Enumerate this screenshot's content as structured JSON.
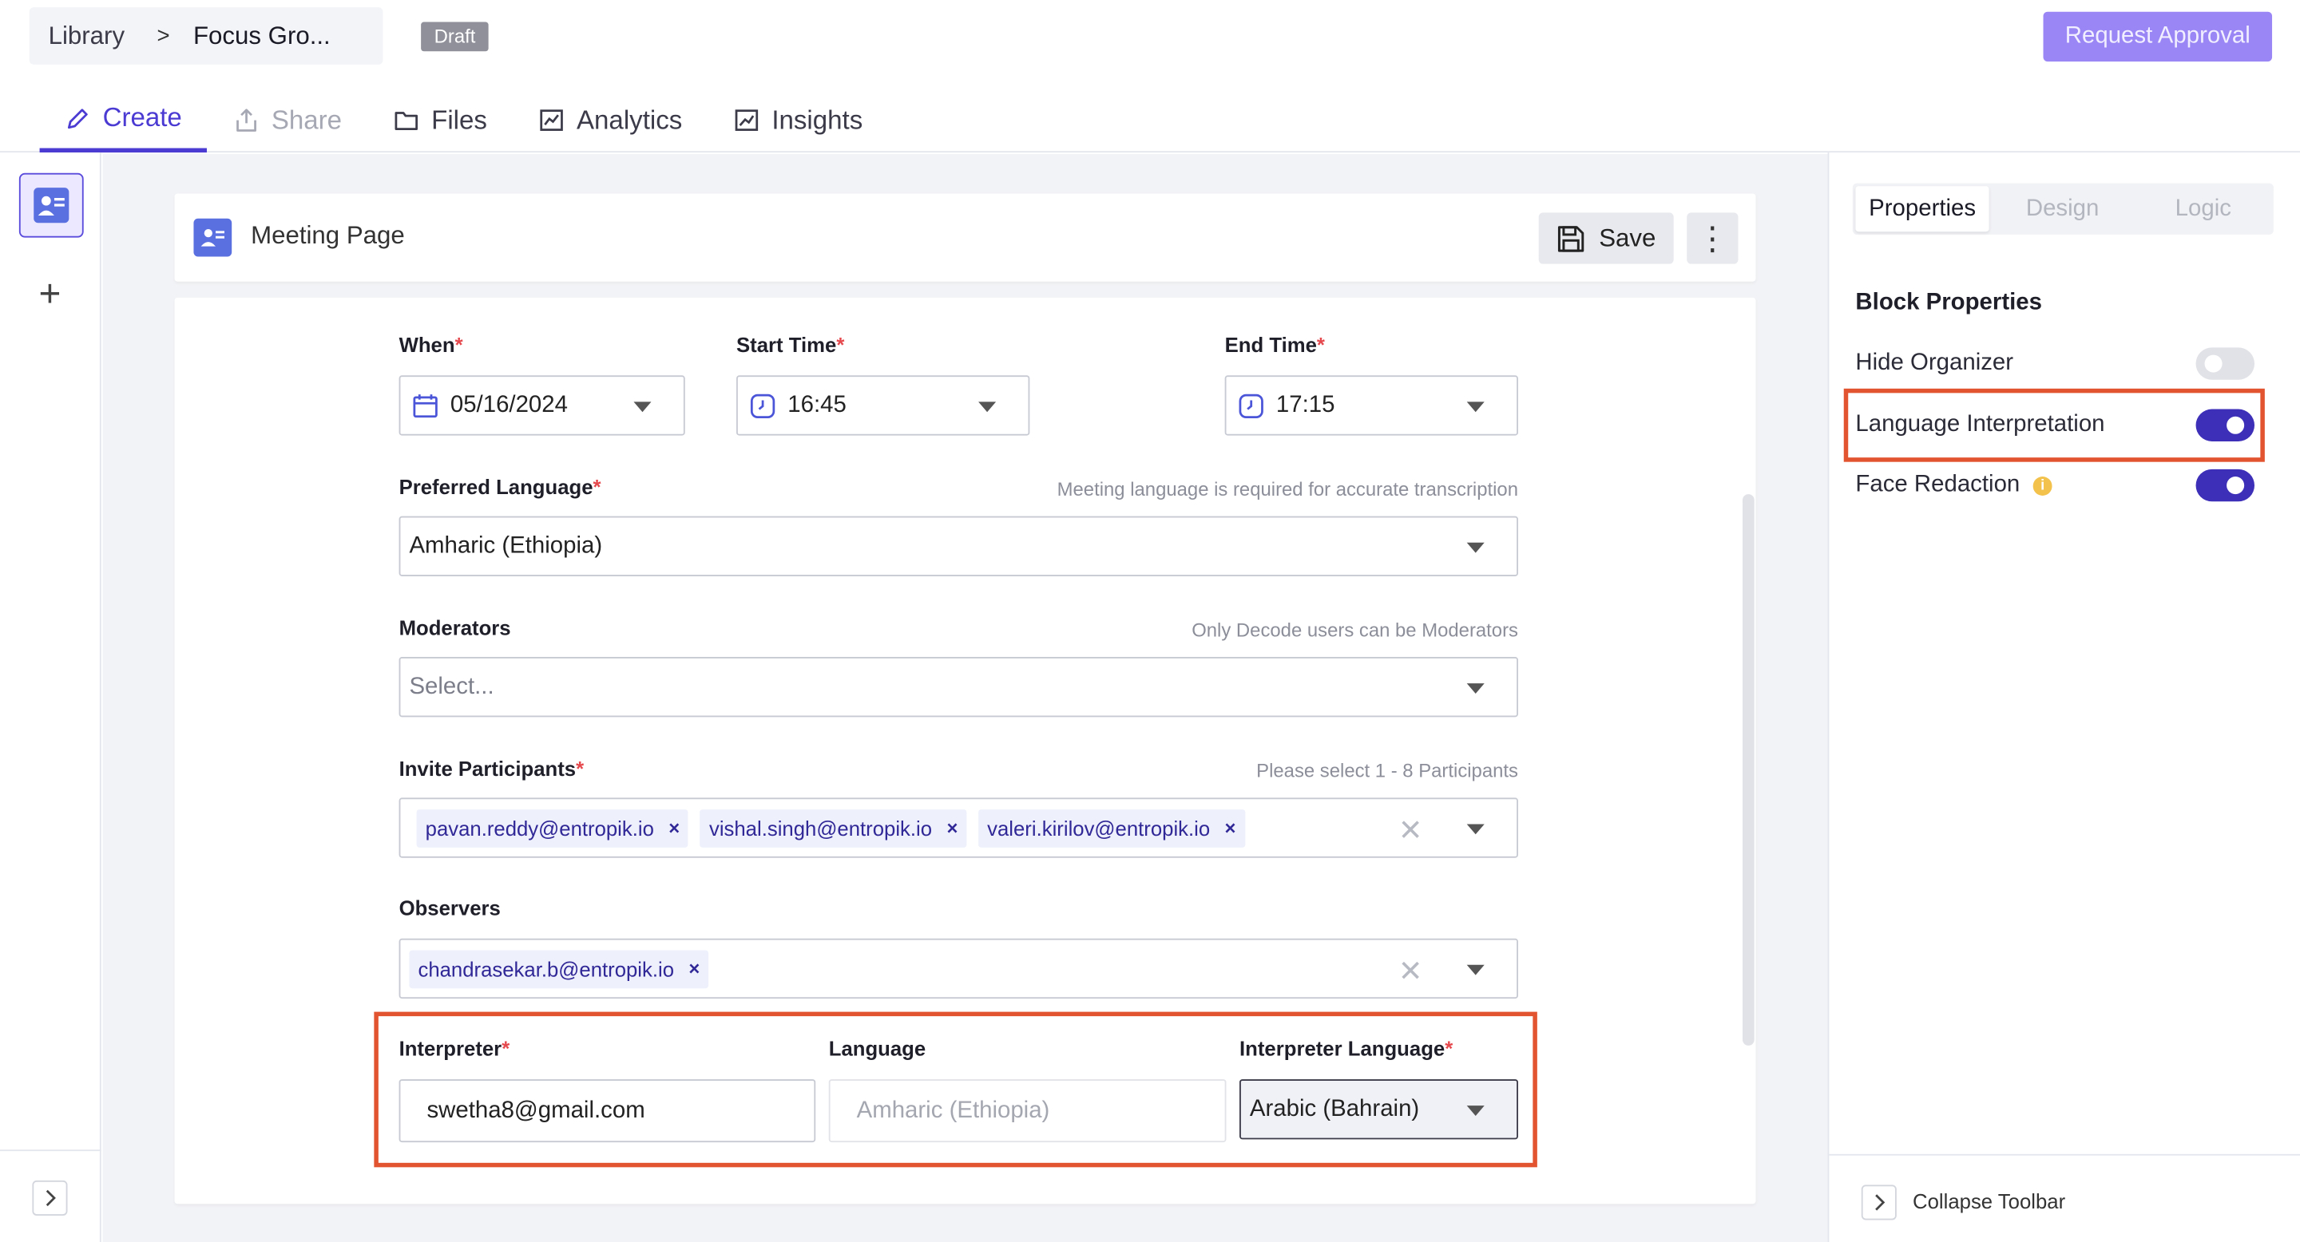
{
  "header": {
    "breadcrumb": {
      "root": "Library",
      "separator": ">",
      "current": "Focus Gro..."
    },
    "status_badge": "Draft",
    "request_approval_label": "Request Approval"
  },
  "tabs": [
    {
      "label": "Create",
      "icon": "pencil-icon",
      "state": "active"
    },
    {
      "label": "Share",
      "icon": "share-icon",
      "state": "disabled"
    },
    {
      "label": "Files",
      "icon": "folder-icon",
      "state": "normal"
    },
    {
      "label": "Analytics",
      "icon": "analytics-icon",
      "state": "normal"
    },
    {
      "label": "Insights",
      "icon": "insights-icon",
      "state": "normal"
    }
  ],
  "page": {
    "title": "Meeting Page",
    "save_label": "Save",
    "more_label": "⋮"
  },
  "form": {
    "when": {
      "label": "When",
      "value": "05/16/2024"
    },
    "start_time": {
      "label": "Start Time",
      "value": "16:45"
    },
    "end_time": {
      "label": "End Time",
      "value": "17:15"
    },
    "preferred_language": {
      "label": "Preferred Language",
      "hint": "Meeting language is required for accurate transcription",
      "value": "Amharic (Ethiopia)"
    },
    "moderators": {
      "label": "Moderators",
      "hint": "Only Decode users can be Moderators",
      "placeholder": "Select..."
    },
    "invite_participants": {
      "label": "Invite Participants",
      "hint": "Please select 1 - 8 Participants",
      "chips": [
        "pavan.reddy@entropik.io",
        "vishal.singh@entropik.io",
        "valeri.kirilov@entropik.io"
      ]
    },
    "observers": {
      "label": "Observers",
      "chips": [
        "chandrasekar.b@entropik.io"
      ]
    },
    "interpreter": {
      "label": "Interpreter",
      "value": "swetha8@gmail.com"
    },
    "language": {
      "label": "Language",
      "value": "Amharic (Ethiopia)"
    },
    "interpreter_language": {
      "label": "Interpreter Language",
      "value": "Arabic (Bahrain)"
    },
    "required_mark": "*",
    "chip_remove": "×",
    "clear_all": "✕"
  },
  "right_panel": {
    "tabs": [
      "Properties",
      "Design",
      "Logic"
    ],
    "section_title": "Block Properties",
    "toggles": [
      {
        "label": "Hide Organizer",
        "on": false
      },
      {
        "label": "Language Interpretation",
        "on": true
      },
      {
        "label": "Face Redaction",
        "on": true,
        "info": "i"
      }
    ],
    "collapse_label": "Collapse Toolbar"
  },
  "colors": {
    "accent": "#4b3bd3",
    "toggle_on": "#3d2fb8",
    "highlight": "#e2542f",
    "request_button": "#9a86f5"
  }
}
